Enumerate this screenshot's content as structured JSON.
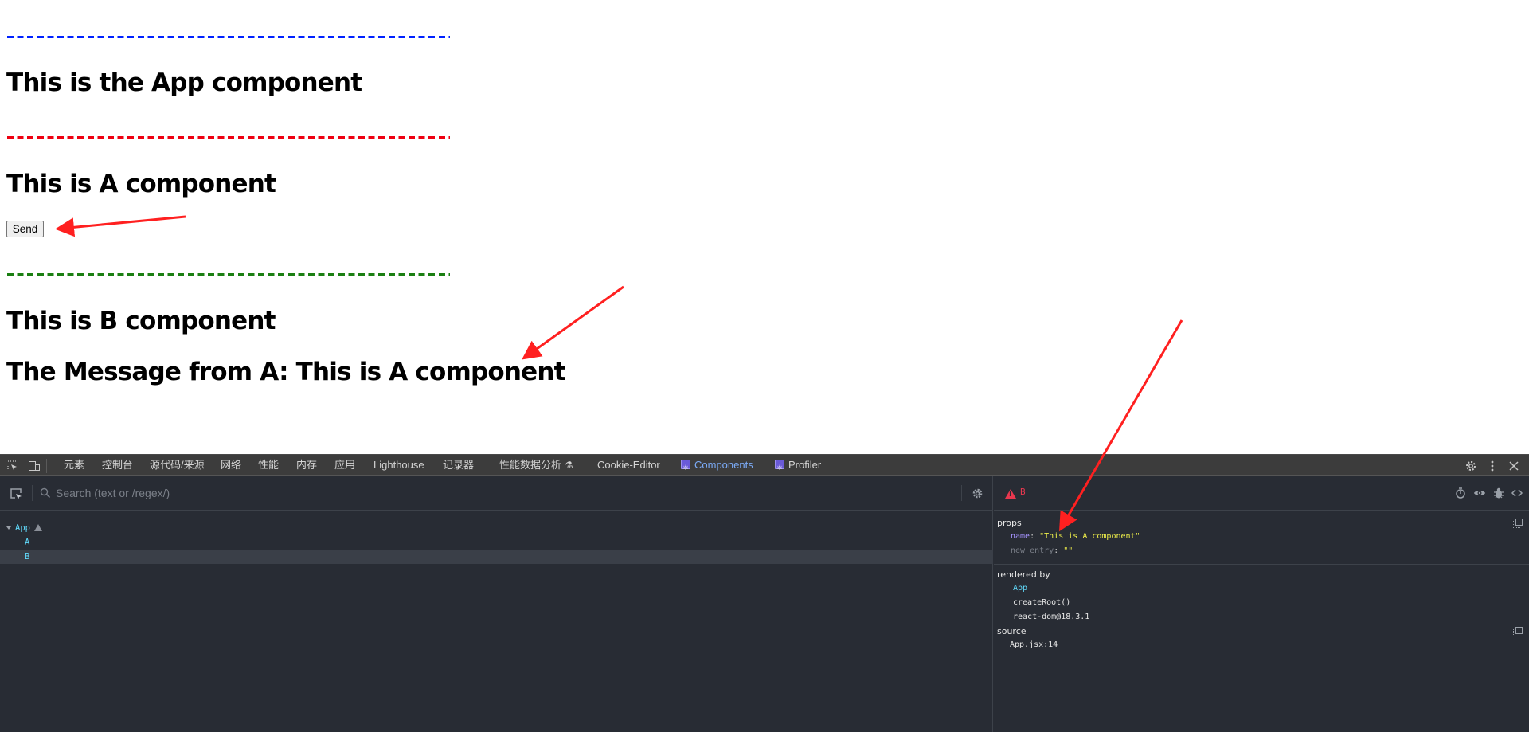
{
  "page": {
    "headings": {
      "app": "This is the App component",
      "a": "This is A component",
      "b": "This is B component",
      "message": "The Message from A: This is A component"
    },
    "send_button_label": "Send",
    "separator_colors": {
      "app": "#0022ff",
      "a": "#ee0011",
      "b": "#1a7f12"
    }
  },
  "devtools": {
    "tabs": [
      {
        "label": "元素"
      },
      {
        "label": "控制台"
      },
      {
        "label": "源代码/来源"
      },
      {
        "label": "网络"
      },
      {
        "label": "性能"
      },
      {
        "label": "内存"
      },
      {
        "label": "应用"
      },
      {
        "label": "Lighthouse"
      },
      {
        "label": "记录器"
      },
      {
        "label": "性能数据分析",
        "icon": "flask-icon"
      },
      {
        "label": "Cookie-Editor"
      },
      {
        "label": "Components",
        "icon": "react-icon",
        "active": true
      },
      {
        "label": "Profiler",
        "icon": "react-icon"
      }
    ],
    "accent_color": "#7cacf8",
    "search": {
      "placeholder": "Search (text or /regex/)",
      "value": ""
    },
    "tree": [
      {
        "name": "App",
        "depth": 0,
        "expanded": true,
        "warning": true
      },
      {
        "name": "A",
        "depth": 1
      },
      {
        "name": "B",
        "depth": 1,
        "selected": true
      }
    ],
    "detail": {
      "selected_component": "B",
      "warning_color": "#e8384f",
      "props_title": "props",
      "props": [
        {
          "key": "name",
          "value": "\"This is A component\""
        },
        {
          "key": "new entry",
          "value": "\"\""
        }
      ],
      "rendered_by_title": "rendered by",
      "rendered_by": [
        "App",
        "createRoot()",
        "react-dom@18.3.1"
      ],
      "source_title": "source",
      "source": "App.jsx:14"
    }
  }
}
